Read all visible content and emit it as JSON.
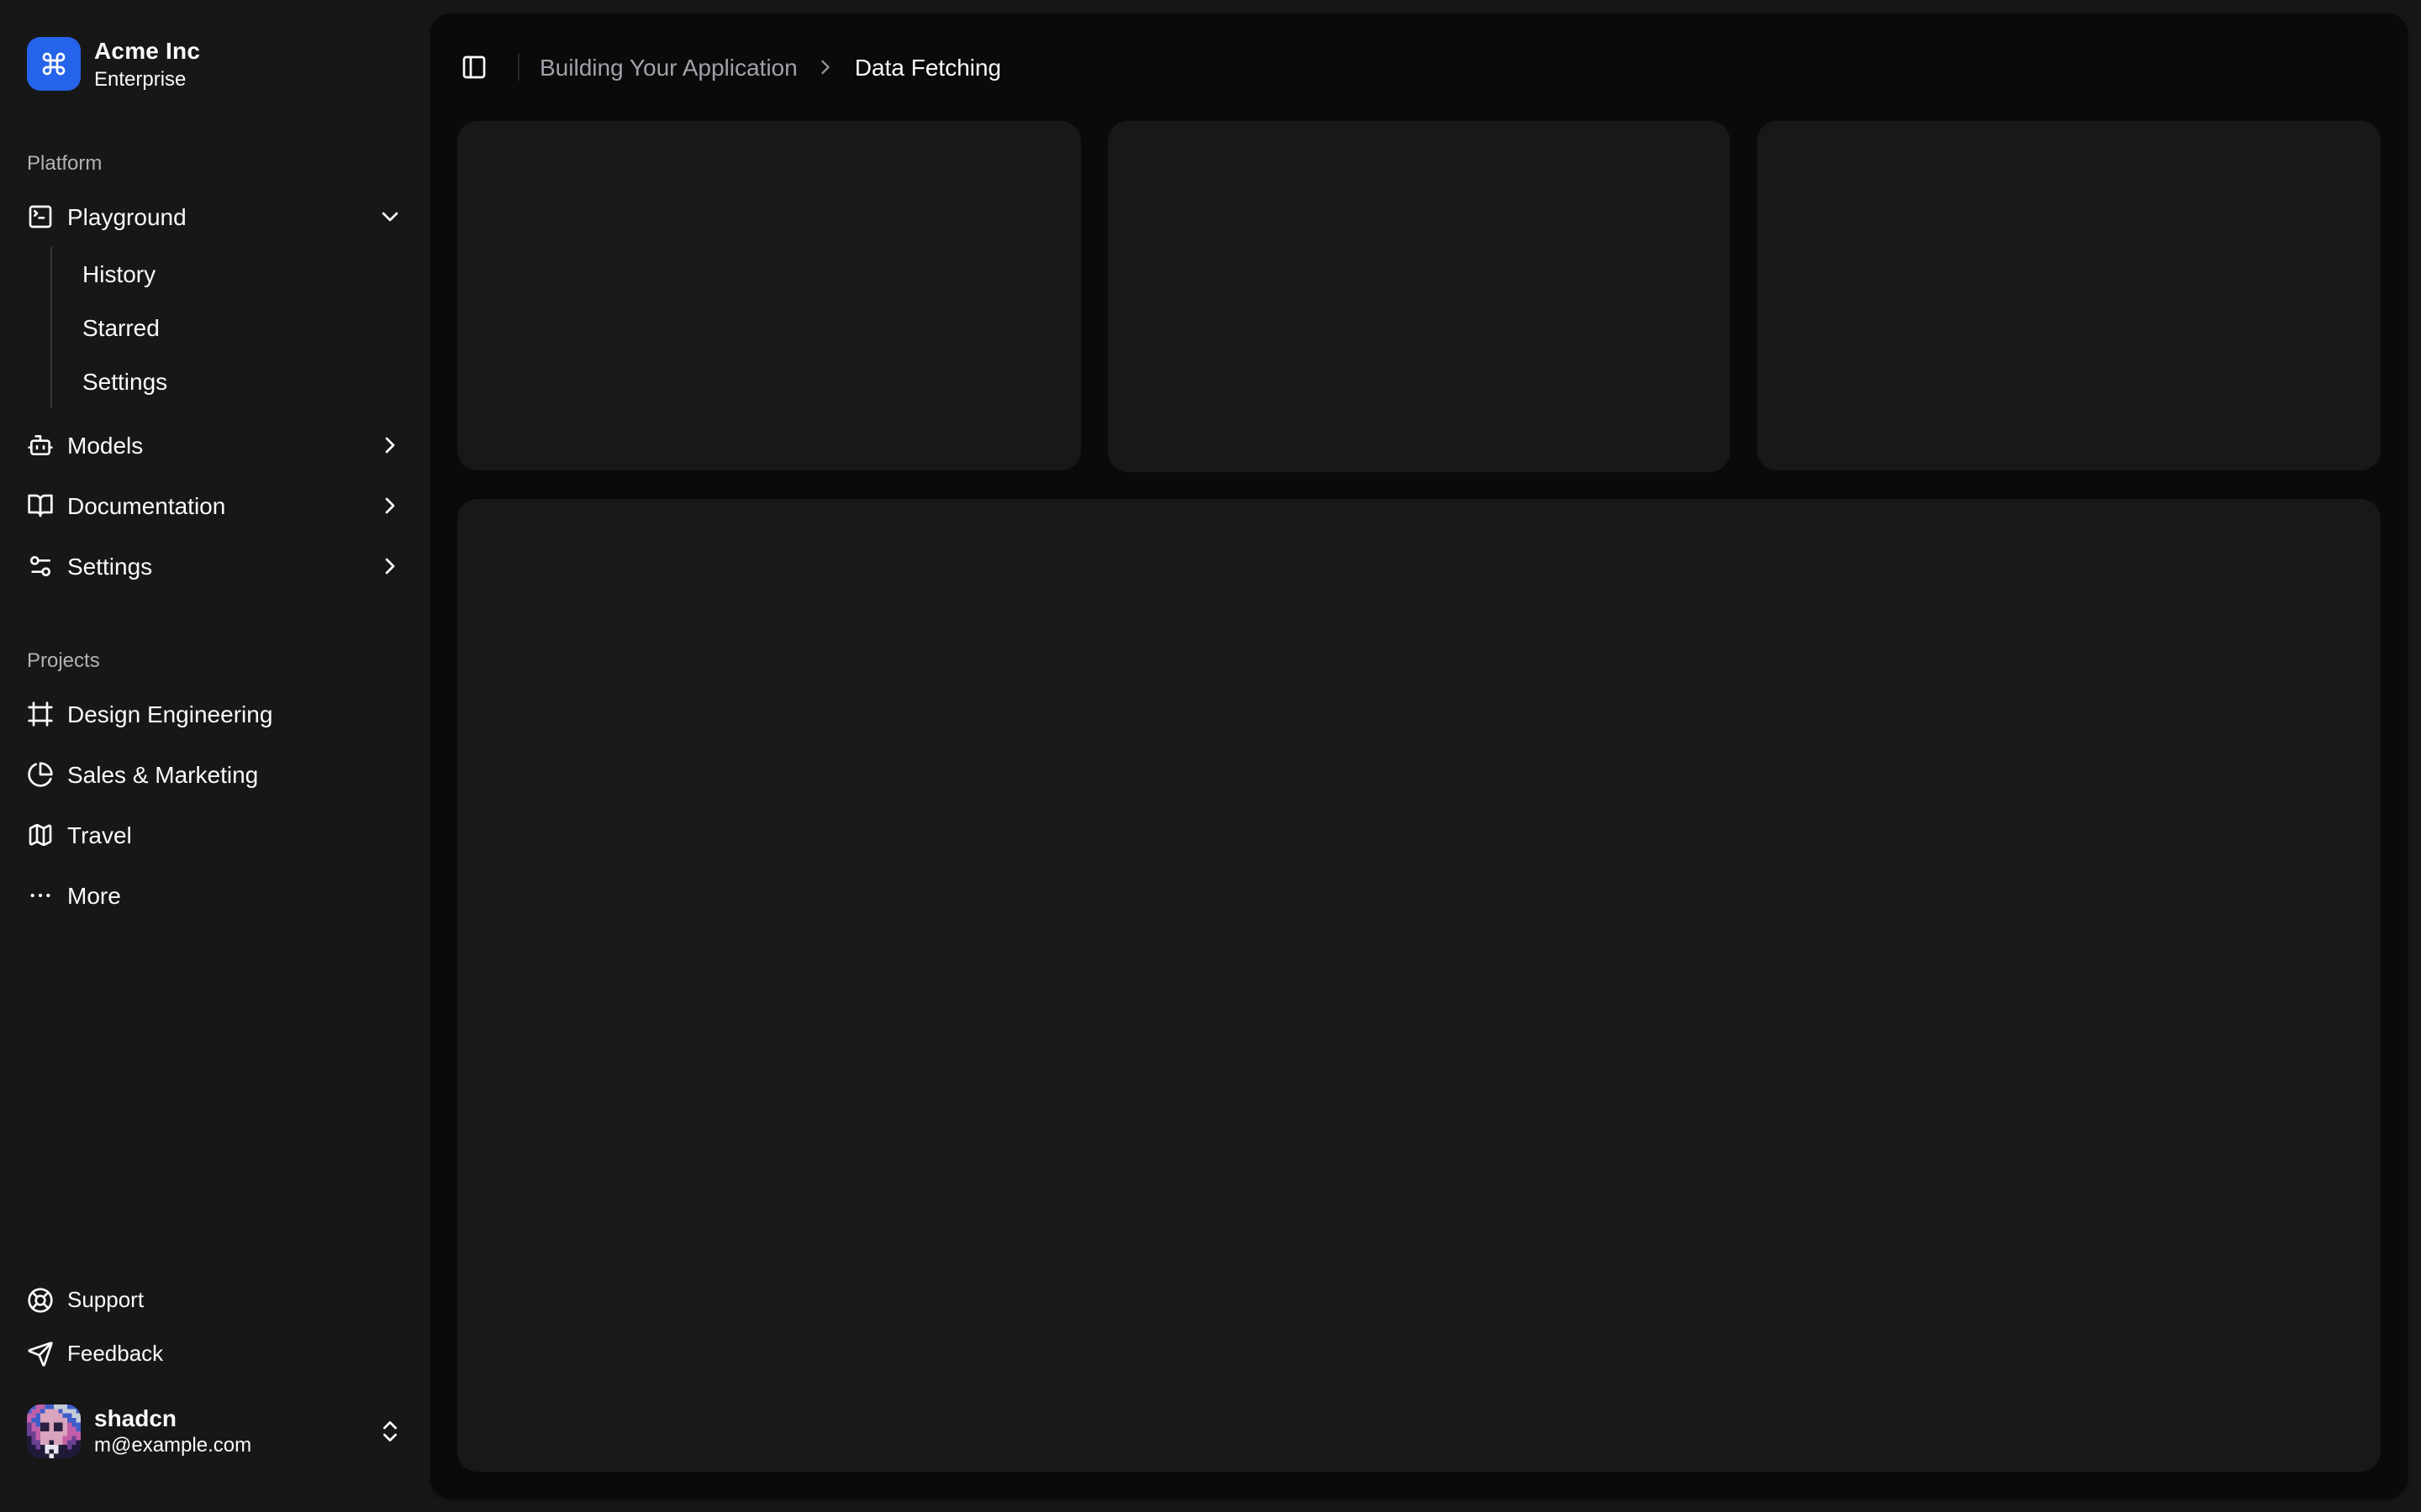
{
  "team": {
    "name": "Acme Inc",
    "plan": "Enterprise",
    "logo_icon": "command-icon",
    "logo_color": "#2563eb"
  },
  "nav": {
    "groups": [
      {
        "label": "Platform",
        "items": [
          {
            "label": "Playground",
            "icon": "square-terminal-icon",
            "state_icon": "chevron-down-icon",
            "expanded": true,
            "children": [
              {
                "label": "History"
              },
              {
                "label": "Starred"
              },
              {
                "label": "Settings"
              }
            ]
          },
          {
            "label": "Models",
            "icon": "bot-icon",
            "state_icon": "chevron-right-icon"
          },
          {
            "label": "Documentation",
            "icon": "book-open-icon",
            "state_icon": "chevron-right-icon"
          },
          {
            "label": "Settings",
            "icon": "settings-sliders-icon",
            "state_icon": "chevron-right-icon"
          }
        ]
      },
      {
        "label": "Projects",
        "items": [
          {
            "label": "Design Engineering",
            "icon": "frame-icon"
          },
          {
            "label": "Sales & Marketing",
            "icon": "pie-chart-icon"
          },
          {
            "label": "Travel",
            "icon": "map-icon"
          },
          {
            "label": "More",
            "icon": "ellipsis-icon"
          }
        ]
      }
    ],
    "secondary": [
      {
        "label": "Support",
        "icon": "life-buoy-icon"
      },
      {
        "label": "Feedback",
        "icon": "send-icon"
      }
    ]
  },
  "user": {
    "name": "shadcn",
    "email": "m@example.com",
    "avatar_icon": "pixel-art-portrait",
    "menu_icon": "chevrons-up-down-icon"
  },
  "header": {
    "toggle_icon": "panel-left-icon",
    "breadcrumb": {
      "parent": "Building Your Application",
      "separator_icon": "chevron-right-icon",
      "current": "Data Fetching"
    }
  },
  "content": {
    "placeholder_card_count": 3
  },
  "colors": {
    "page_bg": "#171717",
    "surface_bg": "#0a0a0a",
    "card_bg": "#181818",
    "accent_blue": "#2563eb",
    "text_primary": "#fafafa",
    "text_muted": "#a1a1aa"
  }
}
